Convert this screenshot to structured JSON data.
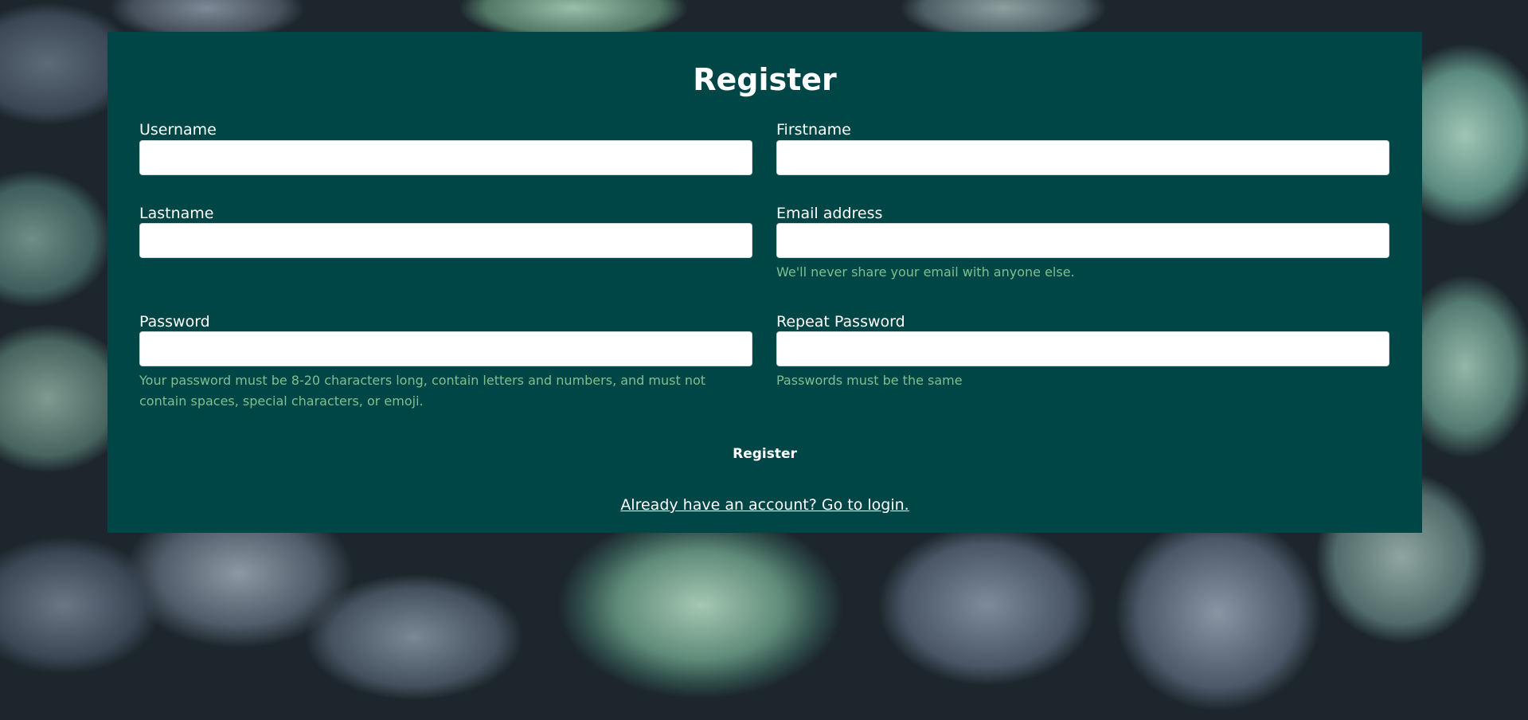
{
  "form": {
    "title": "Register",
    "fields": {
      "username": {
        "label": "Username",
        "value": "",
        "placeholder": ""
      },
      "firstname": {
        "label": "Firstname",
        "value": "",
        "placeholder": ""
      },
      "lastname": {
        "label": "Lastname",
        "value": "",
        "placeholder": ""
      },
      "email": {
        "label": "Email address",
        "value": "",
        "placeholder": "",
        "help": "We'll never share your email with anyone else."
      },
      "password": {
        "label": "Password",
        "value": "",
        "placeholder": "",
        "help": "Your password must be 8-20 characters long, contain letters and numbers, and must not contain spaces, special characters, or emoji."
      },
      "repeat_password": {
        "label": "Repeat Password",
        "value": "",
        "placeholder": "",
        "help": "Passwords must be the same"
      }
    },
    "submit_label": "Register",
    "login_link_label": "Already have an account? Go to login."
  },
  "colors": {
    "panel_background": "#004646",
    "help_text": "#7fbf8f",
    "text": "#ffffff"
  }
}
